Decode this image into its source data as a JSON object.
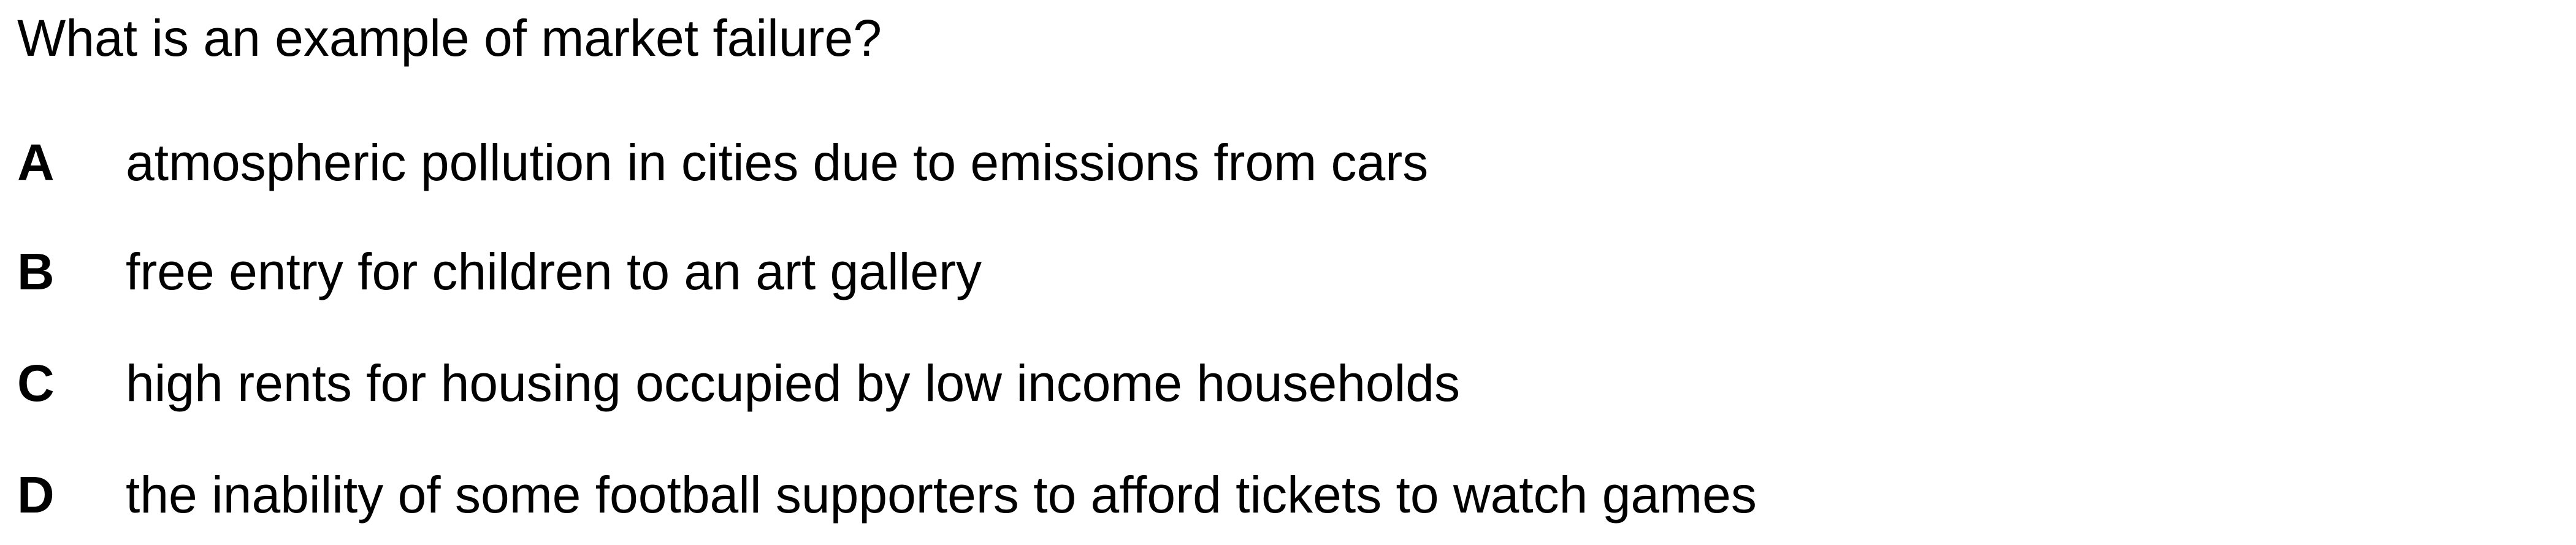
{
  "question": {
    "text": "What is an example of market failure?"
  },
  "options": [
    {
      "letter": "A",
      "text": "atmospheric pollution in cities due to emissions from cars"
    },
    {
      "letter": "B",
      "text": "free entry for children to an art gallery"
    },
    {
      "letter": "C",
      "text": "high rents for housing occupied by low income households"
    },
    {
      "letter": "D",
      "text": "the inability of some football supporters to afford tickets to watch games"
    }
  ]
}
